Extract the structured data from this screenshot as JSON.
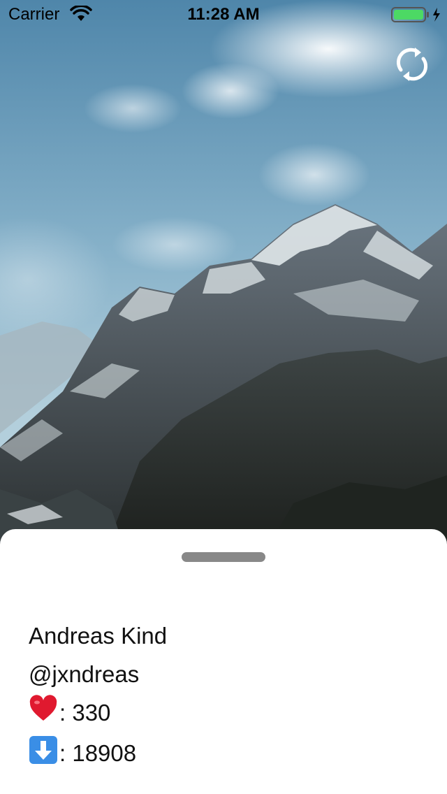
{
  "status_bar": {
    "carrier": "Carrier",
    "time": "11:28 AM",
    "battery_color": "#4cd964"
  },
  "photo": {
    "description_icon": "mountain-photo",
    "refresh_icon": "refresh-icon"
  },
  "profile": {
    "name": "Andreas Kind",
    "username": "@jxndreas",
    "likes_label": ": 330",
    "downloads_label": ": 18908",
    "likes_icon": "heart-icon",
    "downloads_icon": "down-arrow-icon"
  }
}
